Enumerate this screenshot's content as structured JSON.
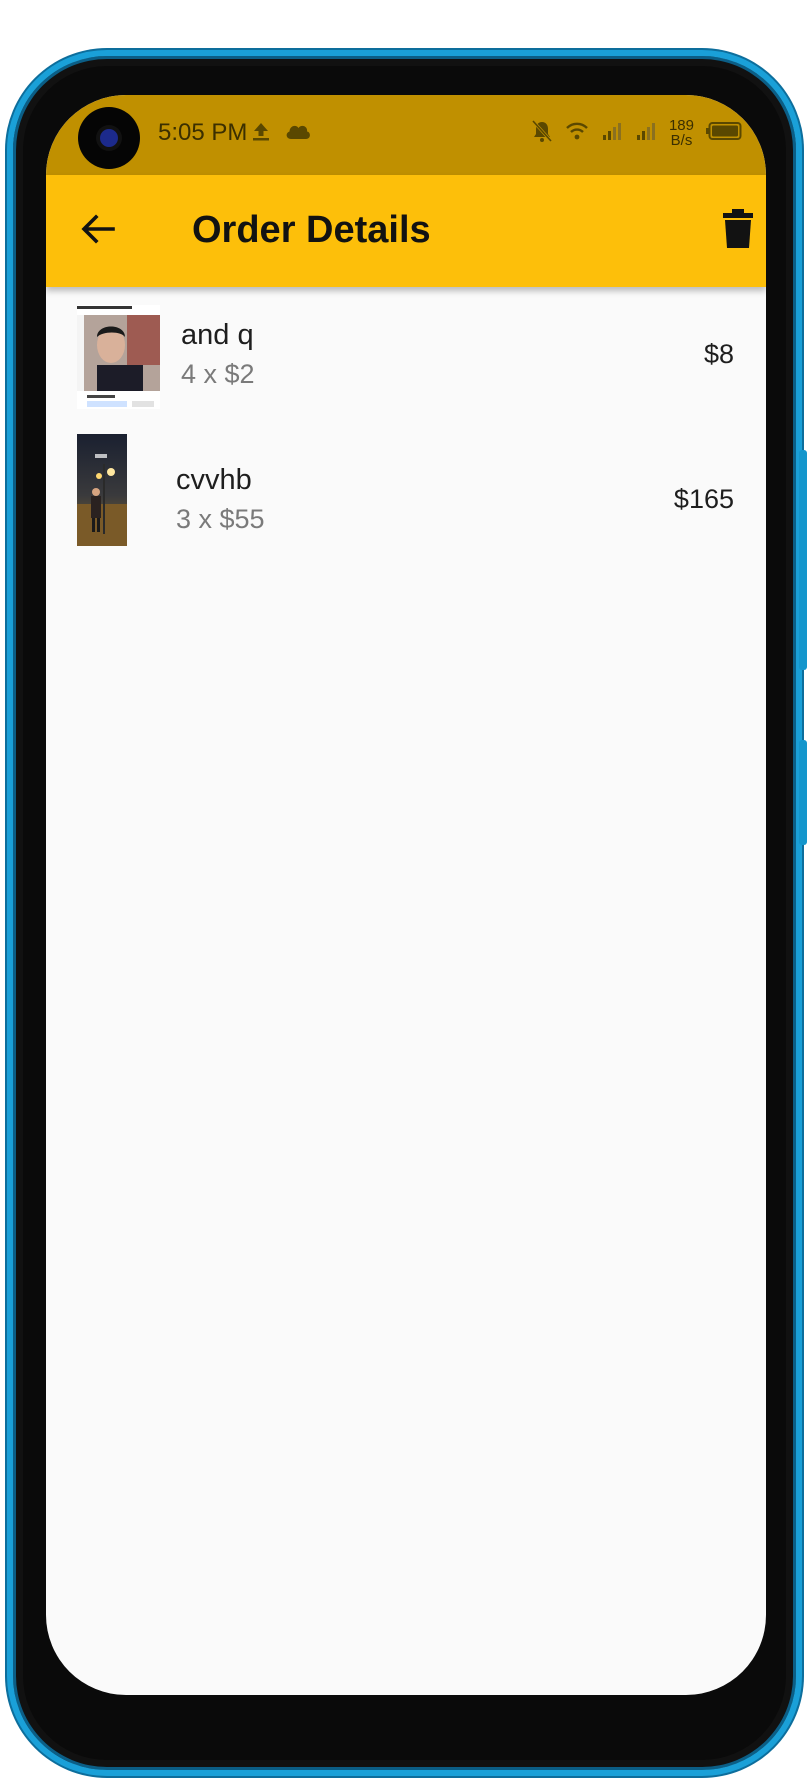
{
  "status_bar": {
    "time": "5:05 PM",
    "net_speed_value": "189",
    "net_speed_unit": "B/s",
    "icons_left": [
      "upload-icon",
      "cloud-icon"
    ],
    "icons_right": [
      "bell-off-icon",
      "wifi-icon",
      "signal-icon",
      "signal-icon",
      "battery-icon"
    ]
  },
  "app_bar": {
    "title": "Order Details",
    "back_icon": "arrow-left-icon",
    "delete_icon": "trash-icon",
    "background": "#fdbf0a",
    "status_background": "#c09000"
  },
  "orders": [
    {
      "name": "and q",
      "quantity_price": "4 x $2",
      "total": "$8",
      "thumbnail": "profile-screenshot-thumbnail"
    },
    {
      "name": "cvvhb",
      "quantity_price": "3 x $55",
      "total": "$165",
      "thumbnail": "night-street-photo-thumbnail"
    }
  ]
}
